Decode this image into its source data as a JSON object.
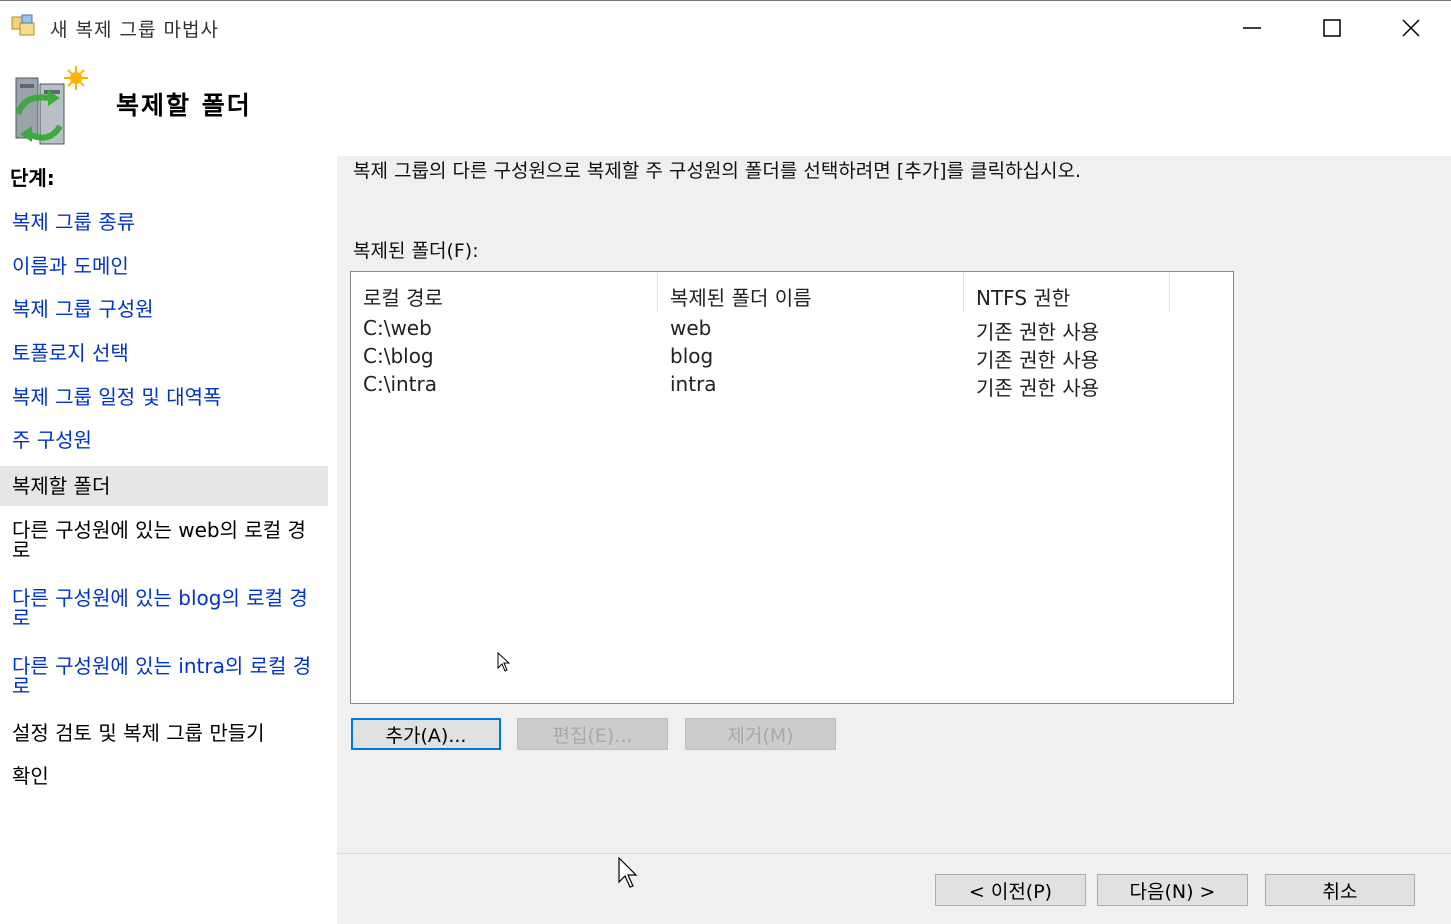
{
  "window": {
    "title": "새 복제 그룹 마법사",
    "icon": "wizard-app-icon",
    "controls": {
      "minimize": "minimize-icon",
      "maximize": "maximize-icon",
      "close": "close-icon"
    }
  },
  "header": {
    "title": "복제할 폴더",
    "icon": "replication-servers-icon"
  },
  "steps": {
    "label": "단계:",
    "items": [
      {
        "label": "복제 그룹 종류",
        "state": "link"
      },
      {
        "label": "이름과 도메인",
        "state": "link"
      },
      {
        "label": "복제 그룹 구성원",
        "state": "link"
      },
      {
        "label": "토폴로지 선택",
        "state": "link"
      },
      {
        "label": "복제 그룹 일정 및 대역폭",
        "state": "link"
      },
      {
        "label": "주 구성원",
        "state": "link"
      },
      {
        "label": "복제할 폴더",
        "state": "current"
      },
      {
        "label": "다른 구성원에 있는 web의 로컬 경로",
        "state": "plain"
      },
      {
        "label": "다른 구성원에 있는 blog의 로컬 경로",
        "state": "link"
      },
      {
        "label": "다른 구성원에 있는 intra의 로컬 경로",
        "state": "link"
      },
      {
        "label": "설정 검토 및 복제 그룹 만들기",
        "state": "plain"
      },
      {
        "label": "확인",
        "state": "plain"
      }
    ]
  },
  "main": {
    "description": "복제 그룹의 다른 구성원으로 복제할 주 구성원의 폴더를 선택하려면 [추가]를 클릭하십시오.",
    "list_label": "복제된 폴더(F):",
    "columns": [
      "로컬 경로",
      "복제된 폴더 이름",
      "NTFS 권한"
    ],
    "rows": [
      [
        "C:\\web",
        "web",
        "기존 권한 사용"
      ],
      [
        "C:\\blog",
        "blog",
        "기존 권한 사용"
      ],
      [
        "C:\\intra",
        "intra",
        "기존 권한 사용"
      ]
    ],
    "buttons": {
      "add": "추가(A)...",
      "edit": "편집(E)...",
      "remove": "제거(M)"
    }
  },
  "footer": {
    "back": "< 이전(P)",
    "next": "다음(N) >",
    "cancel": "취소"
  },
  "colors": {
    "link": "#0033cc",
    "selected_step_bg": "#e6e6e6",
    "pane_bg": "#f0f0f0",
    "focus_border": "#0078d7"
  }
}
